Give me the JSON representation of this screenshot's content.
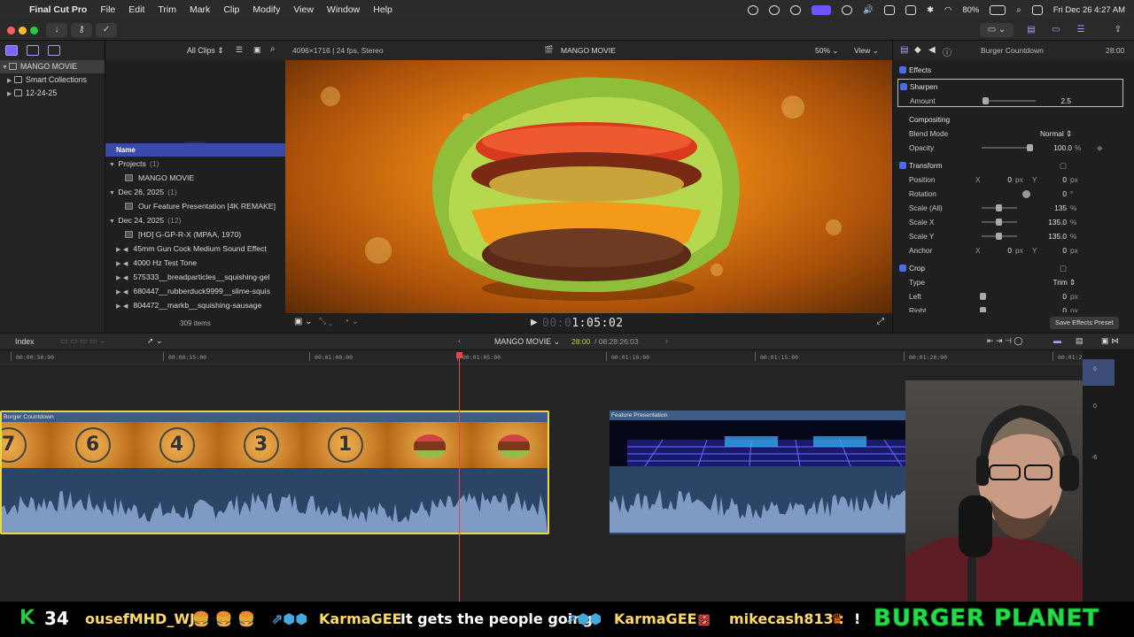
{
  "menubar": {
    "app_name": "Final Cut Pro",
    "items": [
      "File",
      "Edit",
      "Trim",
      "Mark",
      "Clip",
      "Modify",
      "View",
      "Window",
      "Help"
    ],
    "battery": "80%",
    "clock": "Fri Dec 26  4:27 AM"
  },
  "library": {
    "rows": [
      {
        "label": "MANGO MOVIE"
      },
      {
        "label": "Smart Collections"
      },
      {
        "label": "12-24-25"
      }
    ]
  },
  "browser": {
    "filter_label": "All Clips",
    "column_name": "Name",
    "rows": [
      {
        "type": "group",
        "label": "Projects",
        "count": "(1)"
      },
      {
        "type": "item",
        "label": "MANGO MOVIE"
      },
      {
        "type": "group",
        "label": "Dec 26, 2025",
        "count": "(1)"
      },
      {
        "type": "item",
        "label": "Our Feature Presentation [4K REMAKE]"
      },
      {
        "type": "group",
        "label": "Dec 24, 2025",
        "count": "(12)"
      },
      {
        "type": "item",
        "label": "[HD] G-GP-R-X (MPAA, 1970)"
      },
      {
        "type": "audio",
        "label": "45mm Gun Cock Medium Sound Effect"
      },
      {
        "type": "audio",
        "label": "4000 Hz Test Tone"
      },
      {
        "type": "audio",
        "label": "575333__breadparticles__squishing-gel"
      },
      {
        "type": "audio",
        "label": "680447__rubberduck9999__slime-squis"
      },
      {
        "type": "audio",
        "label": "804472__markb__squishing-sausage"
      }
    ],
    "item_count": "309 items"
  },
  "viewer": {
    "format": "4096×1716 | 24 fps, Stereo",
    "project_name": "MANGO MOVIE",
    "zoom": "50%",
    "view_label": "View",
    "timecode_dim": "00:0",
    "timecode": "1:05:02"
  },
  "inspector": {
    "title": "Burger Countdown",
    "duration": "28:00",
    "effects_label": "Effects",
    "sharpen": {
      "label": "Sharpen",
      "amount_label": "Amount",
      "amount": "2.5"
    },
    "compositing": {
      "label": "Compositing",
      "blend_label": "Blend Mode",
      "blend": "Normal",
      "opacity_label": "Opacity",
      "opacity": "100.0",
      "opacity_unit": "%"
    },
    "transform": {
      "label": "Transform",
      "position_label": "Position",
      "pos_x": "0",
      "pos_y": "0",
      "rotation_label": "Rotation",
      "rotation": "0",
      "rotation_unit": "°",
      "scale_all_label": "Scale (All)",
      "scale_all": "135",
      "scale_x_label": "Scale X",
      "scale_x": "135.0",
      "scale_y_label": "Scale Y",
      "scale_y": "135.0",
      "anchor_label": "Anchor",
      "anchor_x": "0",
      "anchor_y": "0",
      "px": "px",
      "pct": "%",
      "x": "X",
      "y": "Y"
    },
    "crop": {
      "label": "Crop",
      "type_label": "Type",
      "type": "Trim",
      "left_label": "Left",
      "left": "0",
      "right_label": "Right",
      "right": "0"
    },
    "save_preset": "Save Effects Preset"
  },
  "timeline": {
    "index_label": "Index",
    "project": "MANGO MOVIE",
    "position": "28:00",
    "total": "/ 08:28:26:03",
    "ticks": [
      "00:00:50:00",
      "00:00:55:00",
      "00:01:00:00",
      "00:01:05:00",
      "00:01:10:00",
      "00:01:15:00",
      "00:01:20:00",
      "00:01:2"
    ],
    "clip1_label": "Burger Countdown",
    "clip2_label": "Feature Presentation",
    "countdown_numbers": [
      "7",
      "6",
      "4",
      "3",
      "1"
    ],
    "meter_labels": [
      "6",
      "0",
      "-6"
    ]
  },
  "ticker": {
    "count": "34",
    "k": "K",
    "segments": [
      {
        "text": "ousefMHD_WJ :",
        "kind": "user"
      },
      {
        "text": "🍔 🍔 🍔",
        "kind": "emoji"
      },
      {
        "text": "KarmaGEE :",
        "kind": "user"
      },
      {
        "text": "It gets the people going",
        "kind": "msg"
      },
      {
        "text": "KarmaGEE :",
        "kind": "user"
      },
      {
        "text": "mikecash813 :",
        "kind": "user"
      },
      {
        "text": "!",
        "kind": "msg"
      }
    ],
    "brand": "BURGER PLANET"
  },
  "colors": {
    "accent": "#4a6cf0",
    "selection": "#e8d84a",
    "clip": "#2f4a6e",
    "playhead": "#e44"
  }
}
